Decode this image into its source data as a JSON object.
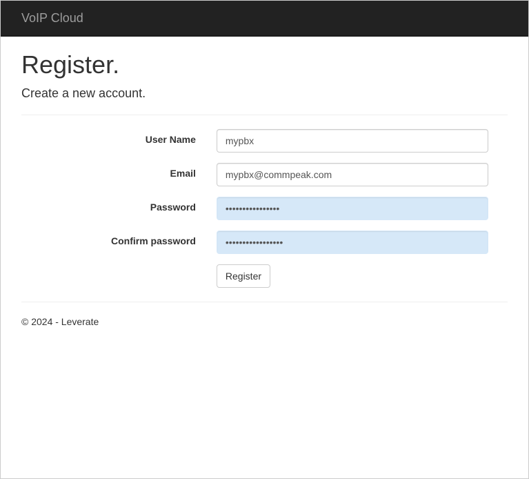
{
  "navbar": {
    "brand": "VoIP Cloud"
  },
  "page": {
    "title": "Register.",
    "subtitle": "Create a new account."
  },
  "form": {
    "username": {
      "label": "User Name",
      "value": "mypbx"
    },
    "email": {
      "label": "Email",
      "value": "mypbx@commpeak.com"
    },
    "password": {
      "label": "Password",
      "value": "••••••••••••••••"
    },
    "confirm_password": {
      "label": "Confirm password",
      "value": "•••••••••••••••••"
    },
    "submit_label": "Register"
  },
  "footer": {
    "text": "© 2024 - Leverate"
  }
}
